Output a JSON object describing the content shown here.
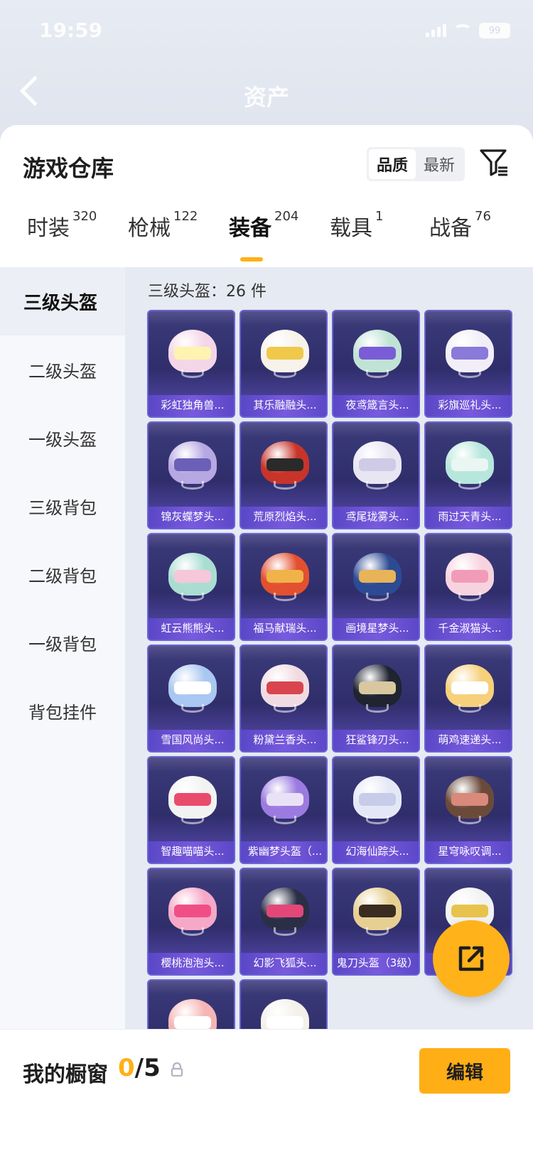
{
  "status_bar": {
    "time": "19:59",
    "battery": "99"
  },
  "nav": {
    "title": "资产"
  },
  "header": {
    "title": "游戏仓库",
    "sort": [
      {
        "label": "品质",
        "active": true
      },
      {
        "label": "最新",
        "active": false
      }
    ]
  },
  "tabs": [
    {
      "label": "时装",
      "count": "320"
    },
    {
      "label": "枪械",
      "count": "122"
    },
    {
      "label": "装备",
      "count": "204",
      "active": true
    },
    {
      "label": "载具",
      "count": "1"
    },
    {
      "label": "战备",
      "count": "76"
    }
  ],
  "categories": [
    {
      "label": "三级头盔",
      "active": true
    },
    {
      "label": "二级头盔"
    },
    {
      "label": "一级头盔"
    },
    {
      "label": "三级背包"
    },
    {
      "label": "二级背包"
    },
    {
      "label": "一级背包"
    },
    {
      "label": "背包挂件"
    }
  ],
  "content": {
    "count_text": "三级头盔：26 件",
    "items": [
      {
        "name": "彩虹独角兽...",
        "shell": "#f4d6e8",
        "visor": "#fff3b0"
      },
      {
        "name": "其乐融融头...",
        "shell": "#f7f2ea",
        "visor": "#f0c84a"
      },
      {
        "name": "夜鸢箴言头...",
        "shell": "#bfe3d5",
        "visor": "#7a5cd6"
      },
      {
        "name": "彩旗巡礼头...",
        "shell": "#f2eef7",
        "visor": "#8a7ad9"
      },
      {
        "name": "锦灰蝶梦头...",
        "shell": "#b7a7e2",
        "visor": "#6b5fb8"
      },
      {
        "name": "荒原烈焰头...",
        "shell": "#c8342a",
        "visor": "#2a2a2a"
      },
      {
        "name": "鸢尾珑雾头...",
        "shell": "#e8e6f2",
        "visor": "#cfcae6"
      },
      {
        "name": "雨过天青头...",
        "shell": "#b7e6dc",
        "visor": "#e9f6f2"
      },
      {
        "name": "虹云熊熊头...",
        "shell": "#a9ddd2",
        "visor": "#f6c7d9"
      },
      {
        "name": "福马献瑞头...",
        "shell": "#e2502f",
        "visor": "#f0b34a"
      },
      {
        "name": "画境星梦头...",
        "shell": "#2d4a94",
        "visor": "#e7b458"
      },
      {
        "name": "千金淑猫头...",
        "shell": "#f7d3df",
        "visor": "#f29bb8"
      },
      {
        "name": "雪国风尚头...",
        "shell": "#a9c7f0",
        "visor": "#ffffff"
      },
      {
        "name": "粉黛兰香头...",
        "shell": "#f1dbe2",
        "visor": "#d9454f"
      },
      {
        "name": "狂鲨锋刃头...",
        "shell": "#1f2430",
        "visor": "#d9c7a0"
      },
      {
        "name": "萌鸡速递头...",
        "shell": "#f6d07a",
        "visor": "#ffffff"
      },
      {
        "name": "智趣喵喵头...",
        "shell": "#f2f2f2",
        "visor": "#e94b6b"
      },
      {
        "name": "紫幽梦头盔（...",
        "shell": "#9b7be0",
        "visor": "#e9e2f6"
      },
      {
        "name": "幻海仙踪头...",
        "shell": "#e4e8f6",
        "visor": "#c7cce8"
      },
      {
        "name": "星穹咏叹调...",
        "shell": "#6b4a3a",
        "visor": "#d98a7a"
      },
      {
        "name": "樱桃泡泡头...",
        "shell": "#f6a8c8",
        "visor": "#f04f86"
      },
      {
        "name": "幻影飞狐头...",
        "shell": "#2b2f45",
        "visor": "#e3477a"
      },
      {
        "name": "鬼刀头盔（3级）",
        "shell": "#e6cf92",
        "visor": "#3a2c20"
      },
      {
        "name": "",
        "shell": "#f2f2f2",
        "visor": "#e8c34c"
      },
      {
        "name": "",
        "shell": "#f6b5b5",
        "visor": "#ffffff"
      },
      {
        "name": "",
        "shell": "#f4f0ea",
        "visor": "#ffffff"
      }
    ]
  },
  "bottom": {
    "label": "我的橱窗",
    "count_current": "0",
    "count_total": "/5",
    "edit_label": "编辑"
  },
  "colors": {
    "accent": "#ffb016",
    "card_top": "#3c3b7a",
    "card_border": "#6a63d6"
  }
}
